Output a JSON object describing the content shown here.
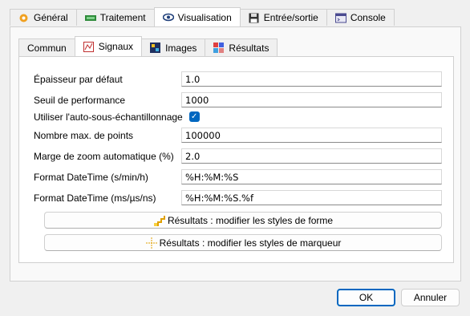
{
  "top_tabs": [
    {
      "label": "Général",
      "icon": "gear-icon"
    },
    {
      "label": "Traitement",
      "icon": "processor-icon"
    },
    {
      "label": "Visualisation",
      "icon": "eye-icon"
    },
    {
      "label": "Entrée/sortie",
      "icon": "floppy-disk-icon"
    },
    {
      "label": "Console",
      "icon": "console-icon"
    }
  ],
  "inner_tabs": [
    {
      "label": "Commun"
    },
    {
      "label": "Signaux",
      "icon": "signal-icon"
    },
    {
      "label": "Images",
      "icon": "image-icon"
    },
    {
      "label": "Résultats",
      "icon": "results-grid-icon"
    }
  ],
  "settings": {
    "line_width": {
      "label": "Épaisseur par défaut",
      "value": "1.0"
    },
    "perf_threshold": {
      "label": "Seuil de performance",
      "value": "1000"
    },
    "auto_downsample": {
      "label": "Utiliser l'auto-sous-échantillonnage",
      "checked": true
    },
    "max_points": {
      "label": "Nombre max. de points",
      "value": "100000"
    },
    "zoom_margin": {
      "label": "Marge de zoom automatique (%)",
      "value": "2.0"
    },
    "datetime_s": {
      "label": "Format DateTime (s/min/h)",
      "value": "%H:%M:%S"
    },
    "datetime_ms": {
      "label": "Format DateTime (ms/µs/ns)",
      "value": "%H:%M:%S.%f"
    }
  },
  "buttons": {
    "shape_styles": "Résultats : modifier les styles de forme",
    "marker_styles": "Résultats : modifier les styles de marqueur",
    "ok": "OK",
    "cancel": "Annuler"
  },
  "colors": {
    "accent": "#0067c0"
  }
}
